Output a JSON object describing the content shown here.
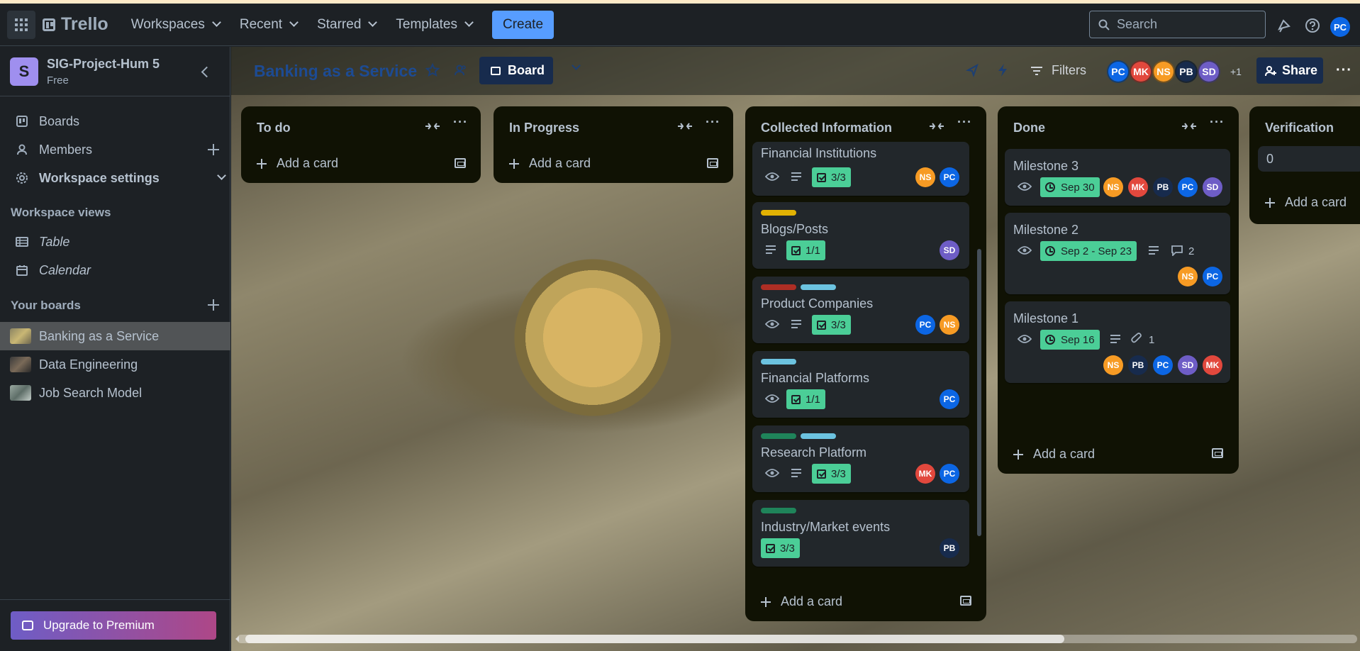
{
  "topnav": {
    "logo": "Trello",
    "menus": [
      "Workspaces",
      "Recent",
      "Starred",
      "Templates"
    ],
    "create_label": "Create",
    "search_placeholder": "Search",
    "user_initials": "PC"
  },
  "sidebar": {
    "workspace_initial": "S",
    "workspace_name": "SIG-Project-Hum 5",
    "workspace_plan": "Free",
    "items": [
      {
        "label": "Boards"
      },
      {
        "label": "Members"
      },
      {
        "label": "Workspace settings"
      }
    ],
    "views_heading": "Workspace views",
    "views": [
      {
        "label": "Table"
      },
      {
        "label": "Calendar"
      }
    ],
    "boards_heading": "Your boards",
    "boards": [
      {
        "label": "Banking as a Service"
      },
      {
        "label": "Data Engineering"
      },
      {
        "label": "Job Search Model"
      }
    ],
    "upgrade_label": "Upgrade to Premium"
  },
  "board": {
    "title": "Banking as a Service",
    "view_label": "Board",
    "filters_label": "Filters",
    "members": [
      {
        "initials": "PC",
        "color": "#0c66e4"
      },
      {
        "initials": "MK",
        "color": "#e2483d"
      },
      {
        "initials": "NS",
        "color": "#f79b24"
      },
      {
        "initials": "PB",
        "color": "#172b4d"
      },
      {
        "initials": "SD",
        "color": "#6e5dc6"
      }
    ],
    "extra_members": "+1",
    "share_label": "Share"
  },
  "lists": {
    "todo": {
      "title": "To do",
      "add_card": "Add a card"
    },
    "inprogress": {
      "title": "In Progress",
      "add_card": "Add a card"
    },
    "collected": {
      "title": "Collected Information",
      "add_card": "Add a card",
      "cards": [
        {
          "title": "Financial Institutions",
          "checklist": "3/3",
          "members": [
            "NS",
            "PC"
          ]
        },
        {
          "title": "Blogs/Posts",
          "checklist": "1/1",
          "members": [
            "SD"
          ]
        },
        {
          "title": "Product Companies",
          "checklist": "3/3",
          "members": [
            "PC",
            "NS"
          ]
        },
        {
          "title": "Financial Platforms",
          "checklist": "1/1",
          "members": [
            "PC"
          ]
        },
        {
          "title": "Research Platform",
          "checklist": "3/3",
          "members": [
            "MK",
            "PC"
          ]
        },
        {
          "title": "Industry/Market events",
          "checklist": "3/3",
          "members": [
            "PB"
          ]
        }
      ]
    },
    "done": {
      "title": "Done",
      "add_card": "Add a card",
      "cards": [
        {
          "title": "Milestone 3",
          "date": "Sep 30",
          "members": [
            "NS",
            "MK",
            "PB",
            "PC",
            "SD"
          ]
        },
        {
          "title": "Milestone 2",
          "date": "Sep 2 - Sep 23",
          "comments": "2",
          "members": [
            "NS",
            "PC"
          ]
        },
        {
          "title": "Milestone 1",
          "date": "Sep 16",
          "attachments": "1",
          "members": [
            "NS",
            "PB",
            "PC",
            "SD",
            "MK"
          ]
        }
      ]
    },
    "verification": {
      "title": "Verification",
      "input_value": "0",
      "add_card": "Add a card"
    }
  },
  "colors": {
    "label_yellow": "#e2b203",
    "label_brown": "#ae2e24",
    "label_sky": "#6cc3e0",
    "label_green": "#1f845a",
    "badge_green": "#4bce97"
  }
}
